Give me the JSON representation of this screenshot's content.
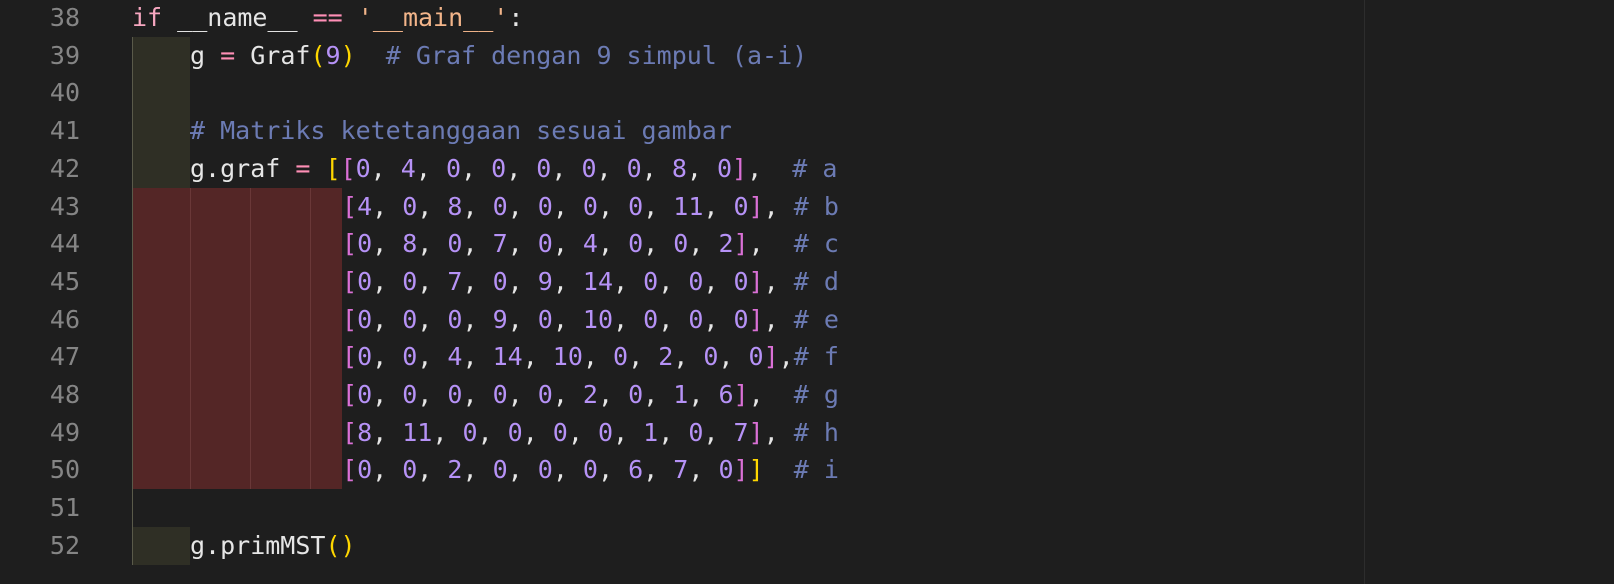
{
  "editor": {
    "lines": [
      {
        "num": "38",
        "tokens": [
          [
            "kw",
            "if"
          ],
          [
            "plain",
            " __name__ "
          ],
          [
            "op",
            "=="
          ],
          [
            "plain",
            " "
          ],
          [
            "str",
            "'__main__'"
          ],
          [
            "plain",
            ":"
          ]
        ]
      },
      {
        "num": "39",
        "tokens": [
          [
            "plain",
            "g "
          ],
          [
            "op",
            "="
          ],
          [
            "plain",
            " Graf"
          ],
          [
            "br1",
            "("
          ],
          [
            "num",
            "9"
          ],
          [
            "br1",
            ")"
          ],
          [
            "plain",
            "  "
          ],
          [
            "cmt",
            "# Graf dengan 9 simpul (a-i)"
          ]
        ]
      },
      {
        "num": "40",
        "tokens": []
      },
      {
        "num": "41",
        "tokens": [
          [
            "cmt",
            "# Matriks ketetanggaan sesuai gambar"
          ]
        ]
      },
      {
        "num": "42",
        "tokens": [
          [
            "plain",
            "g.graf "
          ],
          [
            "op",
            "="
          ],
          [
            "plain",
            " "
          ],
          [
            "br1",
            "["
          ],
          [
            "br2",
            "["
          ],
          [
            "num",
            "0"
          ],
          [
            "plain",
            ", "
          ],
          [
            "num",
            "4"
          ],
          [
            "plain",
            ", "
          ],
          [
            "num",
            "0"
          ],
          [
            "plain",
            ", "
          ],
          [
            "num",
            "0"
          ],
          [
            "plain",
            ", "
          ],
          [
            "num",
            "0"
          ],
          [
            "plain",
            ", "
          ],
          [
            "num",
            "0"
          ],
          [
            "plain",
            ", "
          ],
          [
            "num",
            "0"
          ],
          [
            "plain",
            ", "
          ],
          [
            "num",
            "8"
          ],
          [
            "plain",
            ", "
          ],
          [
            "num",
            "0"
          ],
          [
            "br2",
            "]"
          ],
          [
            "plain",
            ",  "
          ],
          [
            "cmt",
            "# a"
          ]
        ]
      },
      {
        "num": "43",
        "tokens": [
          [
            "br2",
            "["
          ],
          [
            "num",
            "4"
          ],
          [
            "plain",
            ", "
          ],
          [
            "num",
            "0"
          ],
          [
            "plain",
            ", "
          ],
          [
            "num",
            "8"
          ],
          [
            "plain",
            ", "
          ],
          [
            "num",
            "0"
          ],
          [
            "plain",
            ", "
          ],
          [
            "num",
            "0"
          ],
          [
            "plain",
            ", "
          ],
          [
            "num",
            "0"
          ],
          [
            "plain",
            ", "
          ],
          [
            "num",
            "0"
          ],
          [
            "plain",
            ", "
          ],
          [
            "num",
            "11"
          ],
          [
            "plain",
            ", "
          ],
          [
            "num",
            "0"
          ],
          [
            "br2",
            "]"
          ],
          [
            "plain",
            ", "
          ],
          [
            "cmt",
            "# b"
          ]
        ]
      },
      {
        "num": "44",
        "tokens": [
          [
            "br2",
            "["
          ],
          [
            "num",
            "0"
          ],
          [
            "plain",
            ", "
          ],
          [
            "num",
            "8"
          ],
          [
            "plain",
            ", "
          ],
          [
            "num",
            "0"
          ],
          [
            "plain",
            ", "
          ],
          [
            "num",
            "7"
          ],
          [
            "plain",
            ", "
          ],
          [
            "num",
            "0"
          ],
          [
            "plain",
            ", "
          ],
          [
            "num",
            "4"
          ],
          [
            "plain",
            ", "
          ],
          [
            "num",
            "0"
          ],
          [
            "plain",
            ", "
          ],
          [
            "num",
            "0"
          ],
          [
            "plain",
            ", "
          ],
          [
            "num",
            "2"
          ],
          [
            "br2",
            "]"
          ],
          [
            "plain",
            ",  "
          ],
          [
            "cmt",
            "# c"
          ]
        ]
      },
      {
        "num": "45",
        "tokens": [
          [
            "br2",
            "["
          ],
          [
            "num",
            "0"
          ],
          [
            "plain",
            ", "
          ],
          [
            "num",
            "0"
          ],
          [
            "plain",
            ", "
          ],
          [
            "num",
            "7"
          ],
          [
            "plain",
            ", "
          ],
          [
            "num",
            "0"
          ],
          [
            "plain",
            ", "
          ],
          [
            "num",
            "9"
          ],
          [
            "plain",
            ", "
          ],
          [
            "num",
            "14"
          ],
          [
            "plain",
            ", "
          ],
          [
            "num",
            "0"
          ],
          [
            "plain",
            ", "
          ],
          [
            "num",
            "0"
          ],
          [
            "plain",
            ", "
          ],
          [
            "num",
            "0"
          ],
          [
            "br2",
            "]"
          ],
          [
            "plain",
            ", "
          ],
          [
            "cmt",
            "# d"
          ]
        ]
      },
      {
        "num": "46",
        "tokens": [
          [
            "br2",
            "["
          ],
          [
            "num",
            "0"
          ],
          [
            "plain",
            ", "
          ],
          [
            "num",
            "0"
          ],
          [
            "plain",
            ", "
          ],
          [
            "num",
            "0"
          ],
          [
            "plain",
            ", "
          ],
          [
            "num",
            "9"
          ],
          [
            "plain",
            ", "
          ],
          [
            "num",
            "0"
          ],
          [
            "plain",
            ", "
          ],
          [
            "num",
            "10"
          ],
          [
            "plain",
            ", "
          ],
          [
            "num",
            "0"
          ],
          [
            "plain",
            ", "
          ],
          [
            "num",
            "0"
          ],
          [
            "plain",
            ", "
          ],
          [
            "num",
            "0"
          ],
          [
            "br2",
            "]"
          ],
          [
            "plain",
            ", "
          ],
          [
            "cmt",
            "# e"
          ]
        ]
      },
      {
        "num": "47",
        "tokens": [
          [
            "br2",
            "["
          ],
          [
            "num",
            "0"
          ],
          [
            "plain",
            ", "
          ],
          [
            "num",
            "0"
          ],
          [
            "plain",
            ", "
          ],
          [
            "num",
            "4"
          ],
          [
            "plain",
            ", "
          ],
          [
            "num",
            "14"
          ],
          [
            "plain",
            ", "
          ],
          [
            "num",
            "10"
          ],
          [
            "plain",
            ", "
          ],
          [
            "num",
            "0"
          ],
          [
            "plain",
            ", "
          ],
          [
            "num",
            "2"
          ],
          [
            "plain",
            ", "
          ],
          [
            "num",
            "0"
          ],
          [
            "plain",
            ", "
          ],
          [
            "num",
            "0"
          ],
          [
            "br2",
            "]"
          ],
          [
            "plain",
            ","
          ],
          [
            "cmt",
            "# f"
          ]
        ]
      },
      {
        "num": "48",
        "tokens": [
          [
            "br2",
            "["
          ],
          [
            "num",
            "0"
          ],
          [
            "plain",
            ", "
          ],
          [
            "num",
            "0"
          ],
          [
            "plain",
            ", "
          ],
          [
            "num",
            "0"
          ],
          [
            "plain",
            ", "
          ],
          [
            "num",
            "0"
          ],
          [
            "plain",
            ", "
          ],
          [
            "num",
            "0"
          ],
          [
            "plain",
            ", "
          ],
          [
            "num",
            "2"
          ],
          [
            "plain",
            ", "
          ],
          [
            "num",
            "0"
          ],
          [
            "plain",
            ", "
          ],
          [
            "num",
            "1"
          ],
          [
            "plain",
            ", "
          ],
          [
            "num",
            "6"
          ],
          [
            "br2",
            "]"
          ],
          [
            "plain",
            ",  "
          ],
          [
            "cmt",
            "# g"
          ]
        ]
      },
      {
        "num": "49",
        "tokens": [
          [
            "br2",
            "["
          ],
          [
            "num",
            "8"
          ],
          [
            "plain",
            ", "
          ],
          [
            "num",
            "11"
          ],
          [
            "plain",
            ", "
          ],
          [
            "num",
            "0"
          ],
          [
            "plain",
            ", "
          ],
          [
            "num",
            "0"
          ],
          [
            "plain",
            ", "
          ],
          [
            "num",
            "0"
          ],
          [
            "plain",
            ", "
          ],
          [
            "num",
            "0"
          ],
          [
            "plain",
            ", "
          ],
          [
            "num",
            "1"
          ],
          [
            "plain",
            ", "
          ],
          [
            "num",
            "0"
          ],
          [
            "plain",
            ", "
          ],
          [
            "num",
            "7"
          ],
          [
            "br2",
            "]"
          ],
          [
            "plain",
            ", "
          ],
          [
            "cmt",
            "# h"
          ]
        ]
      },
      {
        "num": "50",
        "tokens": [
          [
            "br2",
            "["
          ],
          [
            "num",
            "0"
          ],
          [
            "plain",
            ", "
          ],
          [
            "num",
            "0"
          ],
          [
            "plain",
            ", "
          ],
          [
            "num",
            "2"
          ],
          [
            "plain",
            ", "
          ],
          [
            "num",
            "0"
          ],
          [
            "plain",
            ", "
          ],
          [
            "num",
            "0"
          ],
          [
            "plain",
            ", "
          ],
          [
            "num",
            "0"
          ],
          [
            "plain",
            ", "
          ],
          [
            "num",
            "6"
          ],
          [
            "plain",
            ", "
          ],
          [
            "num",
            "7"
          ],
          [
            "plain",
            ", "
          ],
          [
            "num",
            "0"
          ],
          [
            "br2",
            "]"
          ],
          [
            "br1",
            "]"
          ],
          [
            "plain",
            "  "
          ],
          [
            "cmt",
            "# i"
          ]
        ]
      },
      {
        "num": "51",
        "tokens": []
      },
      {
        "num": "52",
        "tokens": [
          [
            "plain",
            "g.primMST"
          ],
          [
            "br1",
            "("
          ],
          [
            "br1",
            ")"
          ]
        ]
      }
    ]
  }
}
